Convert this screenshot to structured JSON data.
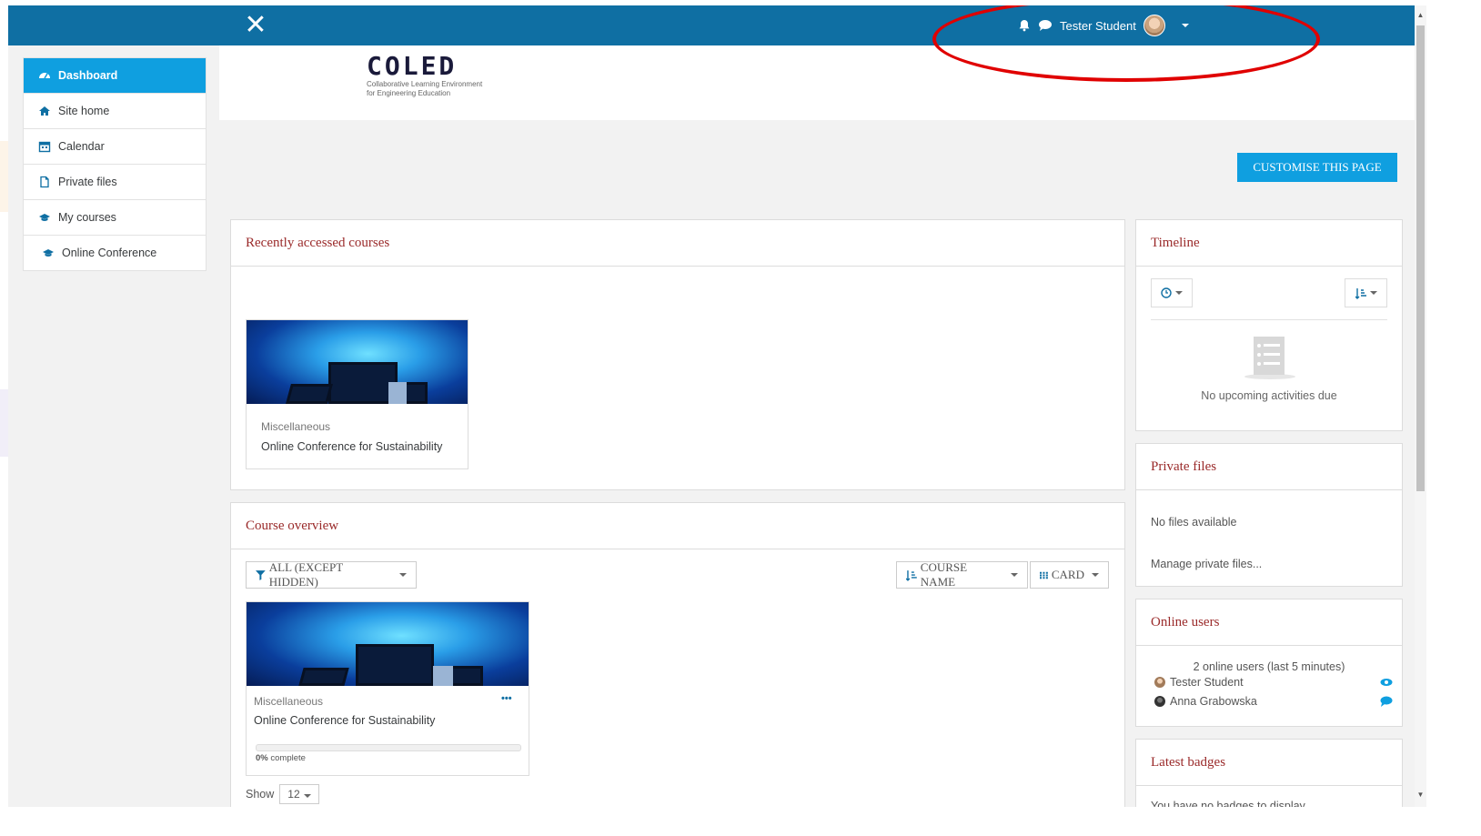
{
  "topbar": {
    "close_glyph": "✕",
    "user_name": "Tester Student",
    "icons": [
      "bell-icon",
      "chat-icon",
      "avatar",
      "caret-down-icon"
    ]
  },
  "sidebar": {
    "items": [
      {
        "label": "Dashboard",
        "icon": "dashboard-icon",
        "active": true
      },
      {
        "label": "Site home",
        "icon": "home-icon"
      },
      {
        "label": "Calendar",
        "icon": "calendar-icon"
      },
      {
        "label": "Private files",
        "icon": "file-icon"
      },
      {
        "label": "My courses",
        "icon": "graduation-cap-icon"
      },
      {
        "label": "Online Conference",
        "icon": "graduation-cap-icon"
      }
    ]
  },
  "header": {
    "logo_text": "COLED",
    "logo_line1": "Collaborative Learning Environment",
    "logo_line2": "for Engineering Education"
  },
  "customise_label": "CUSTOMISE THIS PAGE",
  "recent": {
    "title": "Recently accessed courses",
    "card": {
      "category": "Miscellaneous",
      "name": "Online Conference for Sustainability"
    }
  },
  "overview": {
    "title": "Course overview",
    "filter_label": "ALL (EXCEPT HIDDEN)",
    "sort_label": "COURSE NAME",
    "view_label": "CARD",
    "card": {
      "category": "Miscellaneous",
      "name": "Online Conference for Sustainability",
      "menu": "•••",
      "progress_percent": 0,
      "progress_number": "0%",
      "progress_suffix": " complete"
    },
    "show_label": "Show",
    "show_value": "12"
  },
  "timeline": {
    "title": "Timeline",
    "empty_text": "No upcoming activities due"
  },
  "private_files": {
    "title": "Private files",
    "empty_text": "No files available",
    "manage_link": "Manage private files..."
  },
  "online_users": {
    "title": "Online users",
    "summary": "2 online users (last 5 minutes)",
    "users": [
      {
        "name": "Tester Student",
        "action_icon": "eye-icon"
      },
      {
        "name": "Anna Grabowska",
        "action_icon": "message-icon"
      }
    ]
  },
  "badges": {
    "title": "Latest badges",
    "empty_text": "You have no badges to display"
  },
  "colors": {
    "topbar": "#0f6fa3",
    "accent": "#0f9fe0",
    "block_title": "#9a2a2a",
    "highlight": "#e00000"
  }
}
